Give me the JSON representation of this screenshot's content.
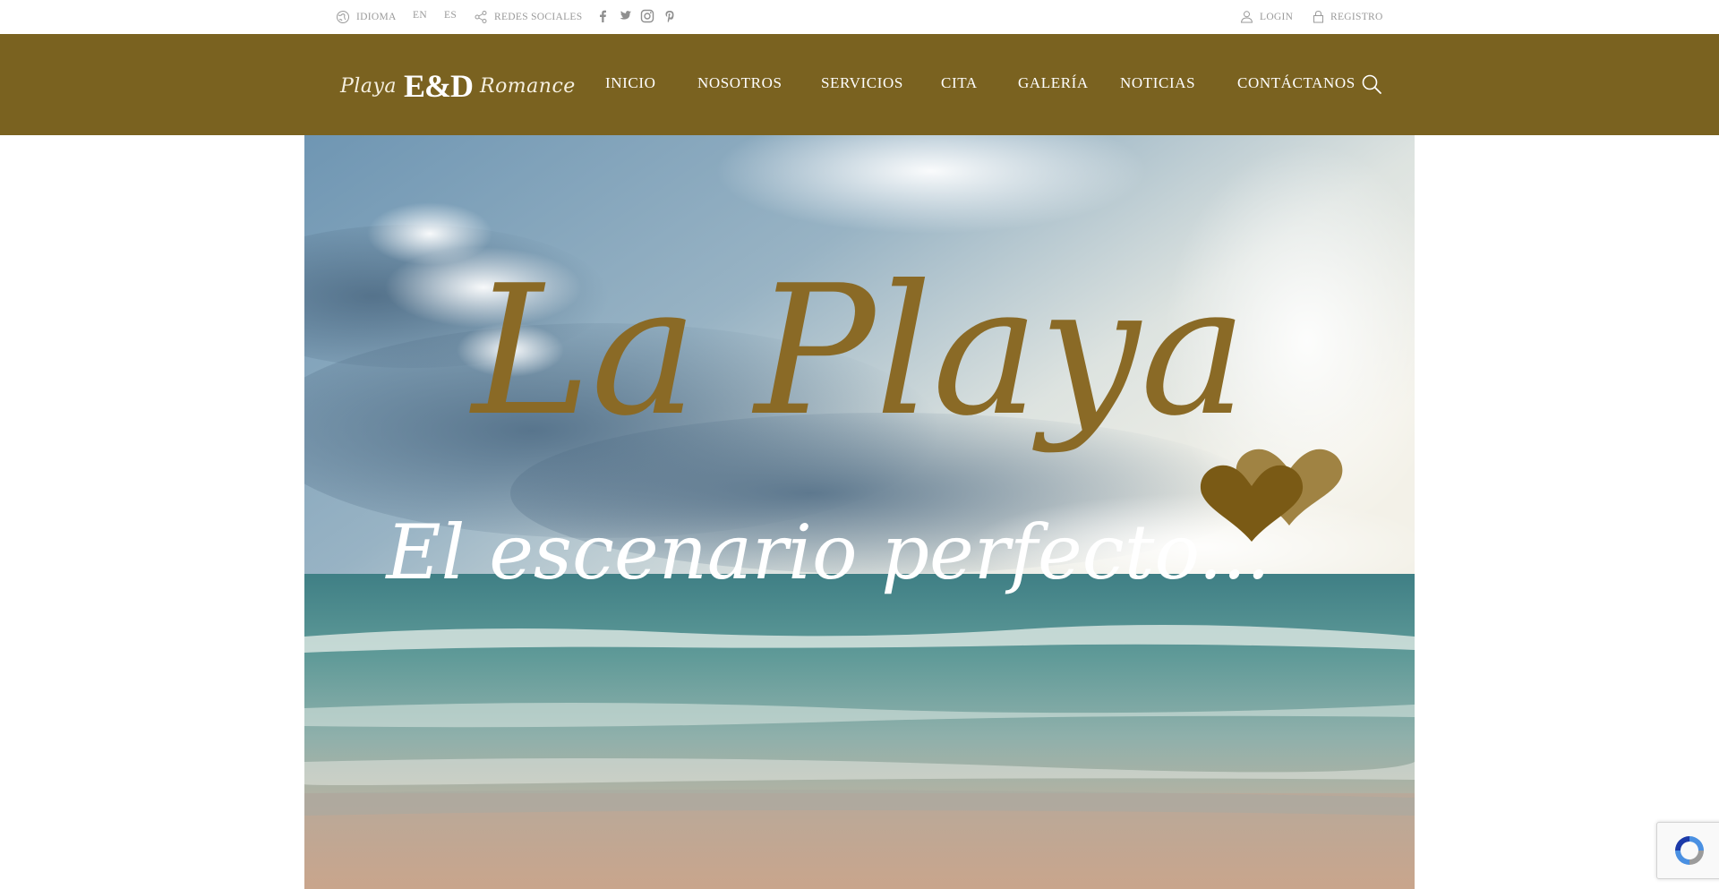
{
  "topbar": {
    "language_label": "IDIOMA",
    "lang_en": "EN",
    "lang_es": "ES",
    "social_label": "REDES SOCIALES",
    "social_icons": [
      "facebook-icon",
      "twitter-icon",
      "instagram-icon",
      "pinterest-icon"
    ],
    "login_label": "LOGIN",
    "register_label": "REGISTRO"
  },
  "brand": {
    "left_script": "Playa",
    "monogram": "E&D",
    "right_script": "Romance"
  },
  "nav": {
    "items": [
      "INICIO",
      "NOSOTROS",
      "SERVICIOS",
      "CITA",
      "GALERÍA",
      "NOTICIAS",
      "CONTÁCTANOS"
    ],
    "search_icon": "search-icon"
  },
  "hero": {
    "title": "La Playa",
    "subtitle": "El escenario perfecto..."
  },
  "colors": {
    "nav_background": "#7a6220",
    "title_gold": "#8a6a26",
    "topbar_text": "#9a9a9a",
    "heart_dark": "#7a5a15",
    "heart_light": "#a08343"
  }
}
